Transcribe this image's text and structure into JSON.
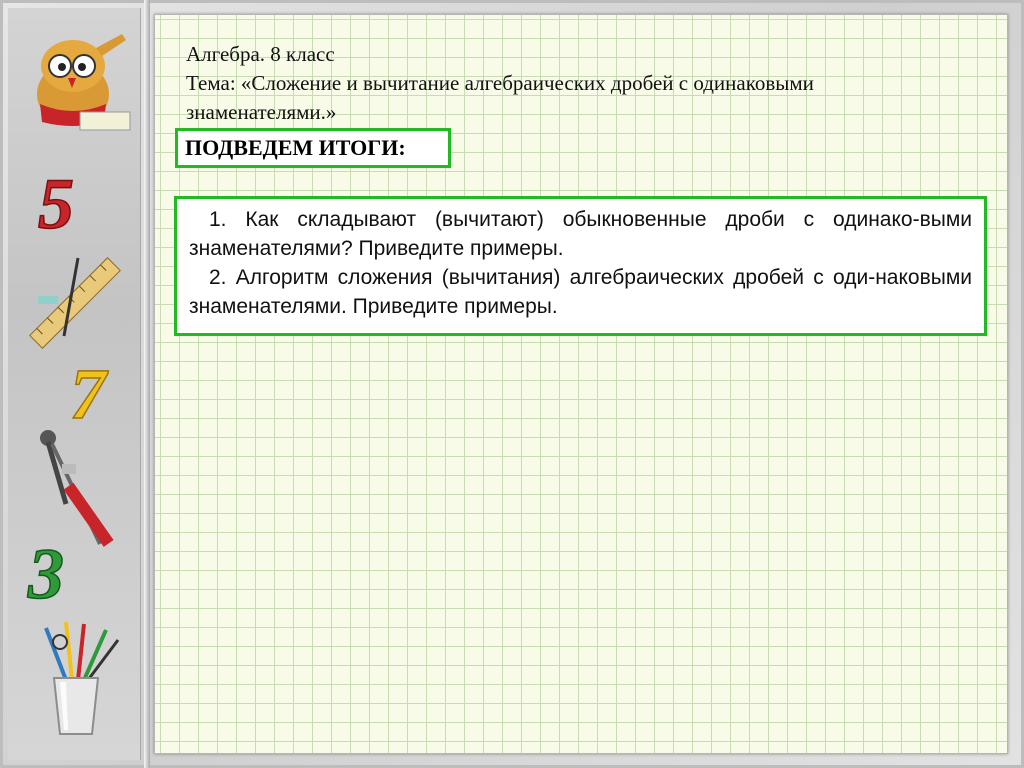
{
  "header": {
    "line1": "Алгебра. 8 класс",
    "line2": "Тема: «Сложение и вычитание алгебраических дробей с одинаковыми",
    "line3": "знаменателями.»"
  },
  "summary_label": "ПОДВЕДЕМ ИТОГИ:",
  "questions": [
    "1. Как складывают (вычитают) обыкновенные дроби с одинако-выми знаменателями? Приведите примеры.",
    "2. Алгоритм сложения (вычитания) алгебраических дробей с оди-наковыми знаменателями. Приведите примеры."
  ],
  "sidebar_digits": {
    "five": "5",
    "seven": "7",
    "three": "3"
  },
  "colors": {
    "accent_green": "#22b922",
    "digit_red": "#c8252b",
    "digit_yellow": "#f0c21b",
    "digit_green": "#2f9a3a"
  }
}
